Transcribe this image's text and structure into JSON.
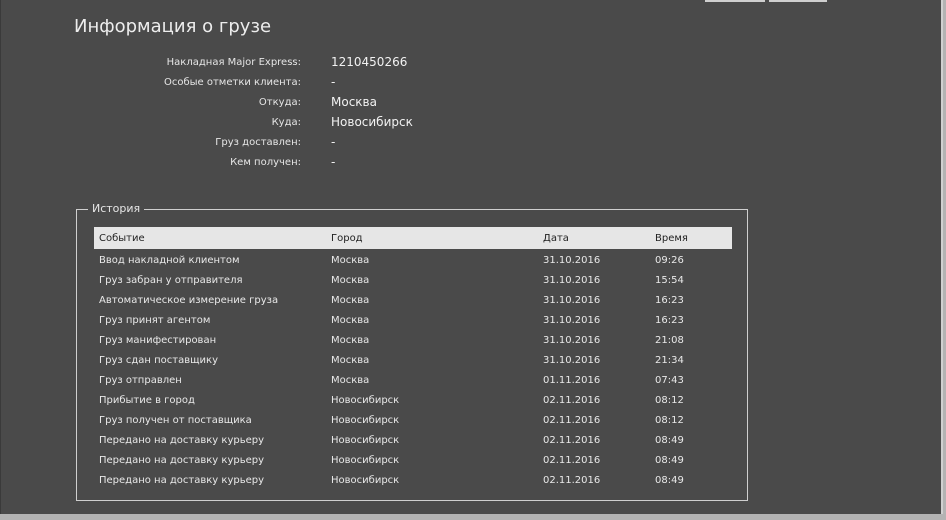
{
  "page": {
    "title": "Информация о грузе"
  },
  "info": [
    {
      "label": "Накладная Major Express:",
      "value": "1210450266"
    },
    {
      "label": "Особые отметки клиента:",
      "value": "-"
    },
    {
      "label": "Откуда:",
      "value": "Москва"
    },
    {
      "label": "Куда:",
      "value": "Новосибирск"
    },
    {
      "label": "Груз доставлен:",
      "value": "-"
    },
    {
      "label": "Кем получен:",
      "value": "-"
    }
  ],
  "history": {
    "legend": "История",
    "columns": {
      "event": "Событие",
      "city": "Город",
      "date": "Дата",
      "time": "Время"
    },
    "rows": [
      {
        "event": "Ввод накладной клиентом",
        "city": "Москва",
        "date": "31.10.2016",
        "time": "09:26"
      },
      {
        "event": "Груз забран у отправителя",
        "city": "Москва",
        "date": "31.10.2016",
        "time": "15:54"
      },
      {
        "event": "Автоматическое измерение груза",
        "city": "Москва",
        "date": "31.10.2016",
        "time": "16:23"
      },
      {
        "event": "Груз принят агентом",
        "city": "Москва",
        "date": "31.10.2016",
        "time": "16:23"
      },
      {
        "event": "Груз манифестирован",
        "city": "Москва",
        "date": "31.10.2016",
        "time": "21:08"
      },
      {
        "event": "Груз сдан поставщику",
        "city": "Москва",
        "date": "31.10.2016",
        "time": "21:34"
      },
      {
        "event": "Груз отправлен",
        "city": "Москва",
        "date": "01.11.2016",
        "time": "07:43"
      },
      {
        "event": "Прибытие в город",
        "city": "Новосибирск",
        "date": "02.11.2016",
        "time": "08:12"
      },
      {
        "event": "Груз получен от поставщика",
        "city": "Новосибирск",
        "date": "02.11.2016",
        "time": "08:12"
      },
      {
        "event": "Передано на доставку курьеру",
        "city": "Новосибирск",
        "date": "02.11.2016",
        "time": "08:49"
      },
      {
        "event": "Передано на доставку курьеру",
        "city": "Новосибирск",
        "date": "02.11.2016",
        "time": "08:49"
      },
      {
        "event": "Передано на доставку курьеру",
        "city": "Новосибирск",
        "date": "02.11.2016",
        "time": "08:49"
      }
    ]
  },
  "colors": {
    "panel_background": "#4a4a4a",
    "page_background": "#b3b3b3",
    "header_row_background": "#e6e6e6",
    "text": "#e9e9e9"
  }
}
